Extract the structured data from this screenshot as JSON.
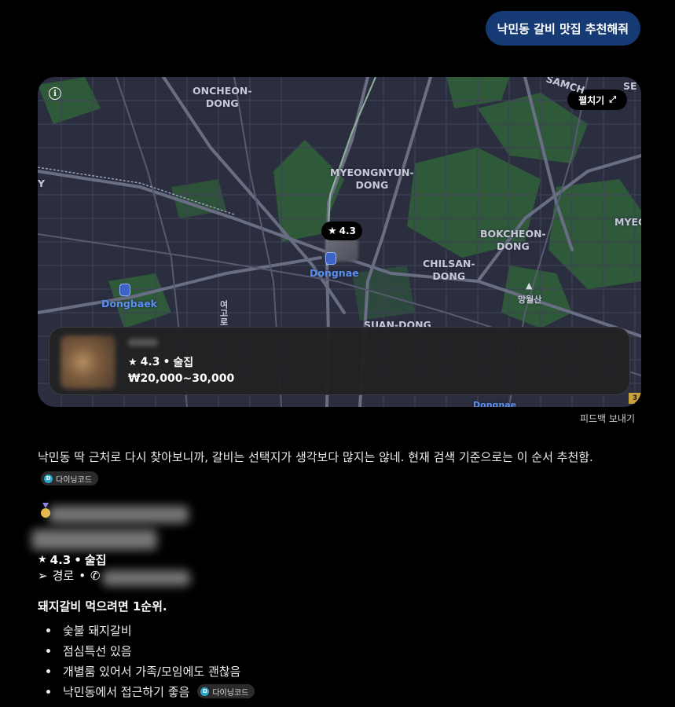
{
  "user_message": "낙민동 갈비 맛집 추천해줘",
  "map": {
    "expand_label": "펼치기",
    "labels": {
      "oncheon": [
        "ONCHEON-",
        "DONG"
      ],
      "myeongnyun": [
        "MYEONGNYUN-",
        "DONG"
      ],
      "bokcheon": [
        "BOKCHEON-",
        "DONG"
      ],
      "chilsan": [
        "CHILSAN-",
        "DONG"
      ],
      "suan": "SUAN-DONG",
      "samchung": "SAMCH",
      "se": "SE",
      "myeo": "MYEO",
      "y": "Y",
      "mangwolsan": "망월산",
      "vertical_road": "여고로",
      "dongnae_bottom": "Dongnae"
    },
    "stations": [
      "Dongnae",
      "Dongbaek"
    ],
    "pin_rating": "4.3",
    "corner_badge": "3"
  },
  "place_card": {
    "rating": "4.3",
    "category": "술집",
    "price": "₩20,000~30,000"
  },
  "feedback_label": "피드백 보내기",
  "answer": {
    "intro": "낙민동 딱 근처로 다시 찾아보니까, 갈비는 선택지가 생각보다 많지는 않네. 현재 검색 기준으로는 이 순서 추천함.",
    "source_chip": "다이닝코드",
    "result": {
      "rating": "4.3",
      "category": "술집",
      "route_label": "경로"
    },
    "highlight": "돼지갈비 먹으려면 1순위.",
    "bullets": [
      "숯불 돼지갈비",
      "점심특선 있음",
      "개별룸 있어서 가족/모임에도 괜찮음",
      "낙민동에서 접근하기 좋음"
    ]
  },
  "colors": {
    "user_bubble": "#163a73",
    "map_bg": "#2b2e3f",
    "park_green": "#2f5a3a",
    "station_blue": "#5b8ff0",
    "chip_accent": "#2aa7c9"
  }
}
